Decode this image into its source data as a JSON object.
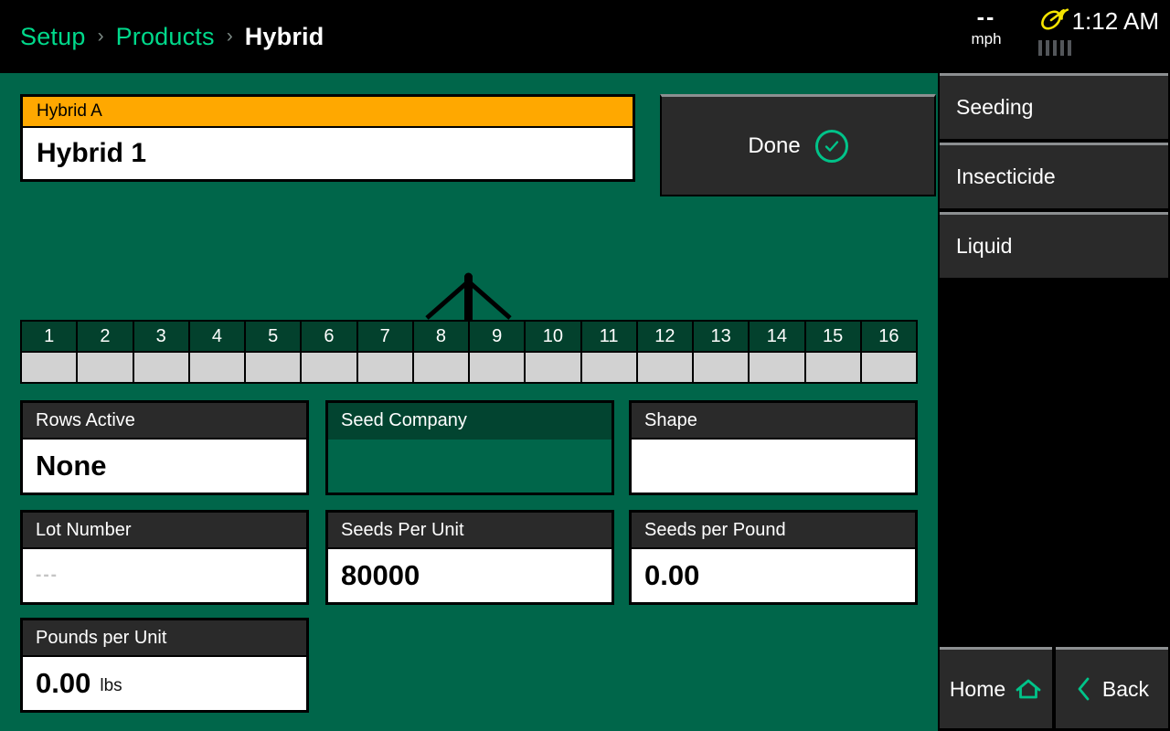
{
  "topbar": {
    "breadcrumb": [
      {
        "label": "Setup",
        "current": false
      },
      {
        "label": "Products",
        "current": false
      },
      {
        "label": "Hybrid",
        "current": true
      }
    ],
    "separator": "›",
    "status": {
      "speed_value": "--",
      "speed_unit": "mph",
      "gps_icon": "satellite-dish-icon",
      "gps_icon_color": "#f5e400",
      "gps_signal_bars": 5,
      "gps_signal_active": 0,
      "time": "1:12 AM"
    }
  },
  "main": {
    "hybrid_name_field": {
      "header": "Hybrid A",
      "value": "Hybrid 1",
      "header_color": "#ffa800"
    },
    "done_button": {
      "label": "Done",
      "icon": "check-circle-icon",
      "icon_color": "#00c389"
    },
    "planter": {
      "diagram": "planter-mast-icon",
      "rows": [
        "1",
        "2",
        "3",
        "4",
        "5",
        "6",
        "7",
        "8",
        "9",
        "10",
        "11",
        "12",
        "13",
        "14",
        "15",
        "16"
      ]
    },
    "fields": [
      {
        "name": "rows-active",
        "header": "Rows Active",
        "value": "None",
        "unit": "",
        "placeholder": "",
        "enabled": true
      },
      {
        "name": "seed-company",
        "header": "Seed Company",
        "value": "",
        "unit": "",
        "placeholder": "",
        "enabled": false
      },
      {
        "name": "shape",
        "header": "Shape",
        "value": "",
        "unit": "",
        "placeholder": "",
        "enabled": true
      },
      {
        "name": "lot-number",
        "header": "Lot Number",
        "value": "",
        "unit": "",
        "placeholder": "---",
        "enabled": true
      },
      {
        "name": "seeds-per-unit",
        "header": "Seeds Per Unit",
        "value": "80000",
        "unit": "",
        "placeholder": "",
        "enabled": true
      },
      {
        "name": "seeds-per-pound",
        "header": "Seeds per Pound",
        "value": "0.00",
        "unit": "",
        "placeholder": "",
        "enabled": true
      },
      {
        "name": "pounds-per-unit",
        "header": "Pounds per Unit",
        "value": "0.00",
        "unit": "lbs",
        "placeholder": "",
        "enabled": true
      }
    ]
  },
  "sidebar": {
    "items": [
      {
        "label": "Seeding"
      },
      {
        "label": "Insecticide"
      },
      {
        "label": "Liquid"
      }
    ],
    "nav": {
      "home_label": "Home",
      "home_icon": "home-icon",
      "back_label": "Back",
      "back_icon": "chevron-left-icon",
      "icon_color": "#00c389"
    }
  },
  "colors": {
    "background_green": "#00664a",
    "panel_dark": "#2a2a2a",
    "accent_green": "#00d98b",
    "accent_orange": "#ffa800",
    "row_header_green": "#03412d"
  }
}
